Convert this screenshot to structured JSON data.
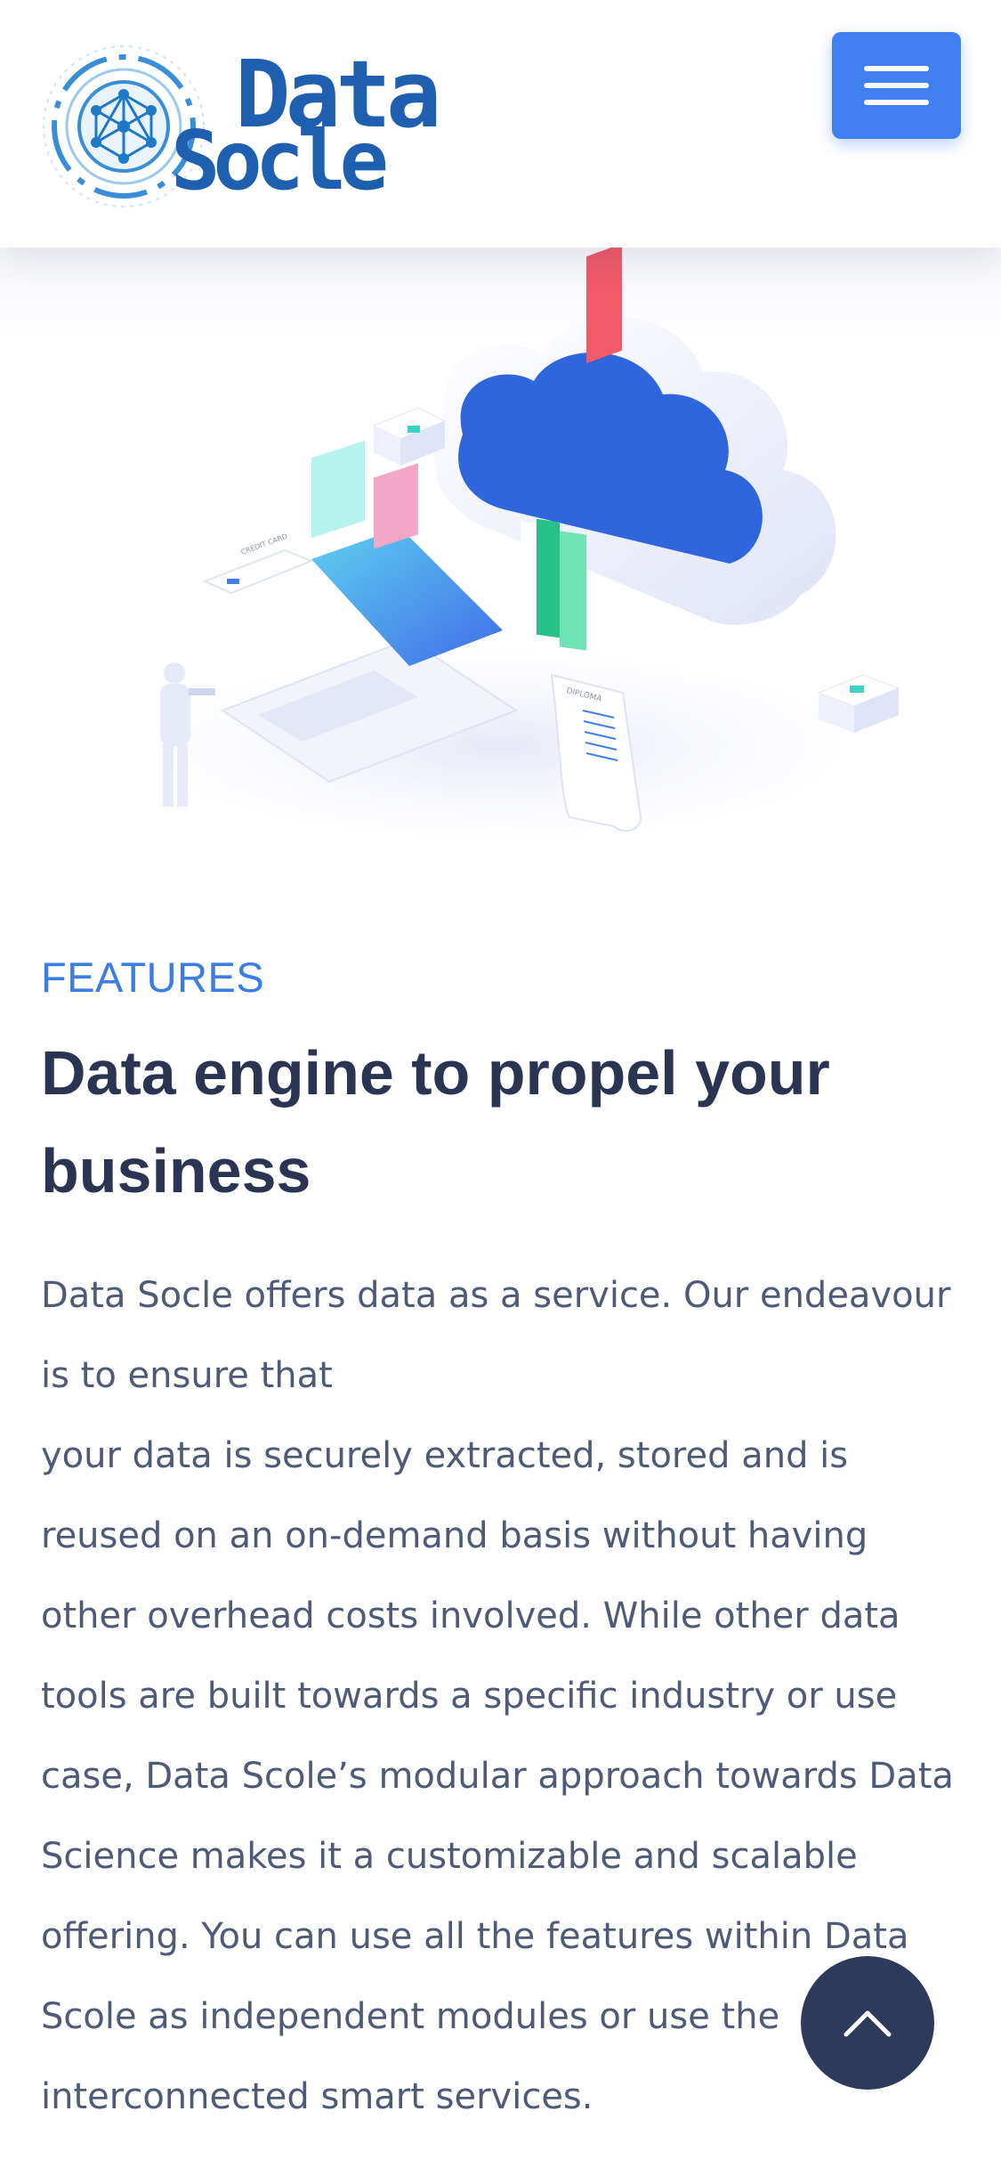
{
  "header": {
    "logo_top_text": "Data",
    "logo_bottom_text": "Socle",
    "menu_icon": "hamburger-icon"
  },
  "hero": {
    "illustration": "cloud-data-storage-illustration",
    "card_label": "CREDIT CARD",
    "scroll_label": "DIPLOMA"
  },
  "features": {
    "eyebrow": "FEATURES",
    "title": "Data engine to propel your business",
    "body": "Data Socle offers data as a service. Our endeavour is to ensure that\nyour data is securely extracted, stored and is reused on an on-demand basis without having other overhead costs involved. While other data tools are built towards a specific industry or use case, Data Scole’s modular approach towards Data Science makes it a customizable and scalable offering. You can use all the features within Data Scole as independent modules or use the interconnected smart services."
  },
  "scroll_top": {
    "icon": "chevron-up-icon"
  },
  "colors": {
    "accent": "#3f7ff0",
    "heading": "#2b3452",
    "body": "#4e5a78",
    "logo": "#1f5fb0",
    "scroll_button": "#2e3a5c"
  }
}
